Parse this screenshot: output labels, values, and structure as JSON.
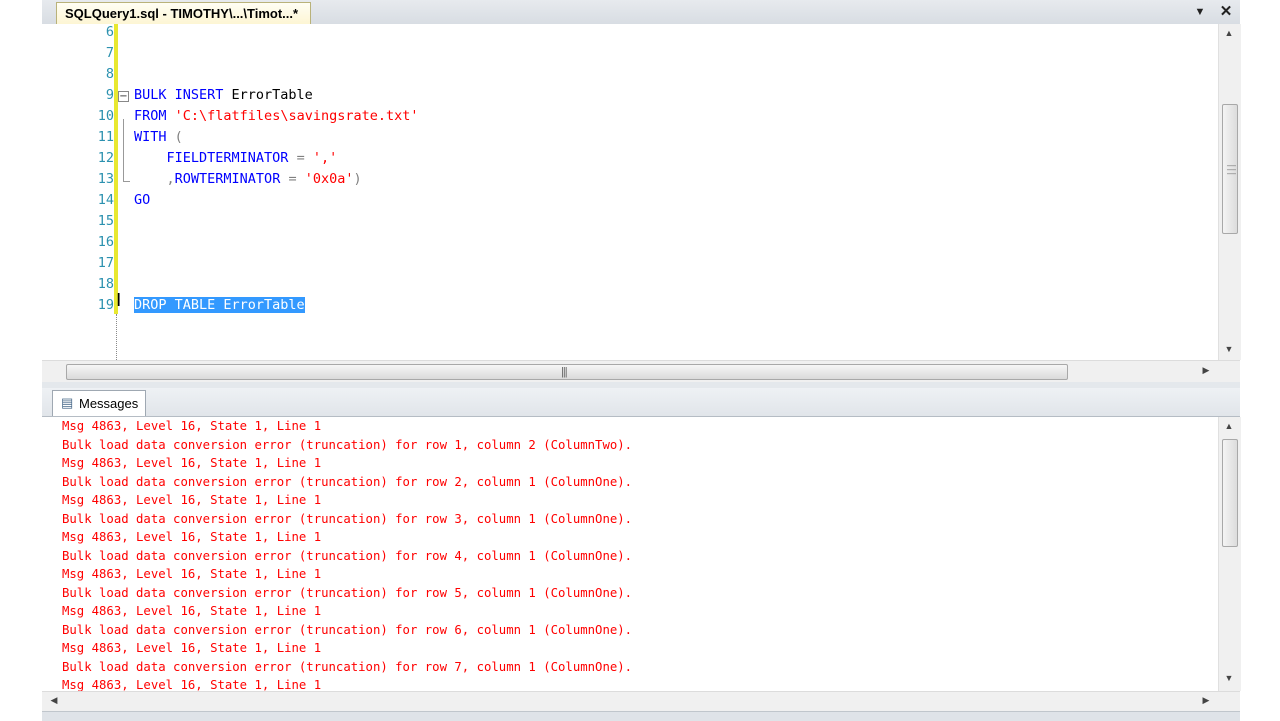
{
  "tab": {
    "title": "SQLQuery1.sql - TIMOTHY\\...\\Timot...*",
    "dropdown_glyph": "▼",
    "close_glyph": "✕"
  },
  "editor": {
    "lines": [
      {
        "num": "6"
      },
      {
        "num": "7"
      },
      {
        "num": "8"
      },
      {
        "num": "9",
        "parts": [
          [
            "kw",
            "BULK INSERT"
          ],
          [
            "txt",
            " ErrorTable"
          ]
        ]
      },
      {
        "num": "10",
        "parts": [
          [
            "kw",
            "FROM"
          ],
          [
            "txt",
            " "
          ],
          [
            "str",
            "'C:\\flatfiles\\savingsrate.txt'"
          ]
        ]
      },
      {
        "num": "11",
        "parts": [
          [
            "kw",
            "WITH"
          ],
          [
            "txt",
            " "
          ],
          [
            "op",
            "("
          ]
        ]
      },
      {
        "num": "12",
        "parts": [
          [
            "txt",
            "    "
          ],
          [
            "kw",
            "FIELDTERMINATOR"
          ],
          [
            "txt",
            " "
          ],
          [
            "op",
            "="
          ],
          [
            "txt",
            " "
          ],
          [
            "str",
            "','"
          ]
        ]
      },
      {
        "num": "13",
        "parts": [
          [
            "txt",
            "    "
          ],
          [
            "op",
            ","
          ],
          [
            "kw",
            "ROWTERMINATOR"
          ],
          [
            "txt",
            " "
          ],
          [
            "op",
            "="
          ],
          [
            "txt",
            " "
          ],
          [
            "str",
            "'0x0a'"
          ],
          [
            "op",
            ")"
          ]
        ]
      },
      {
        "num": "14",
        "parts": [
          [
            "kw",
            "GO"
          ]
        ]
      },
      {
        "num": "15"
      },
      {
        "num": "16"
      },
      {
        "num": "17"
      },
      {
        "num": "18"
      },
      {
        "num": "19",
        "parts": [
          [
            "sel",
            "DROP TABLE ErrorTable"
          ]
        ]
      }
    ],
    "outline_glyph": "−"
  },
  "results": {
    "tab_label": "Messages",
    "messages": [
      "Msg 4863, Level 16, State 1, Line 1",
      "Bulk load data conversion error (truncation) for row 1, column 2 (ColumnTwo).",
      "Msg 4863, Level 16, State 1, Line 1",
      "Bulk load data conversion error (truncation) for row 2, column 1 (ColumnOne).",
      "Msg 4863, Level 16, State 1, Line 1",
      "Bulk load data conversion error (truncation) for row 3, column 1 (ColumnOne).",
      "Msg 4863, Level 16, State 1, Line 1",
      "Bulk load data conversion error (truncation) for row 4, column 1 (ColumnOne).",
      "Msg 4863, Level 16, State 1, Line 1",
      "Bulk load data conversion error (truncation) for row 5, column 1 (ColumnOne).",
      "Msg 4863, Level 16, State 1, Line 1",
      "Bulk load data conversion error (truncation) for row 6, column 1 (ColumnOne).",
      "Msg 4863, Level 16, State 1, Line 1",
      "Bulk load data conversion error (truncation) for row 7, column 1 (ColumnOne).",
      "Msg 4863, Level 16, State 1, Line 1"
    ]
  },
  "colors": {
    "keyword": "#0000ff",
    "string": "#ff0000",
    "line_number": "#2b91af",
    "selection": "#3399ff",
    "error_text": "#ff0000",
    "change_bar": "#e8e830"
  }
}
